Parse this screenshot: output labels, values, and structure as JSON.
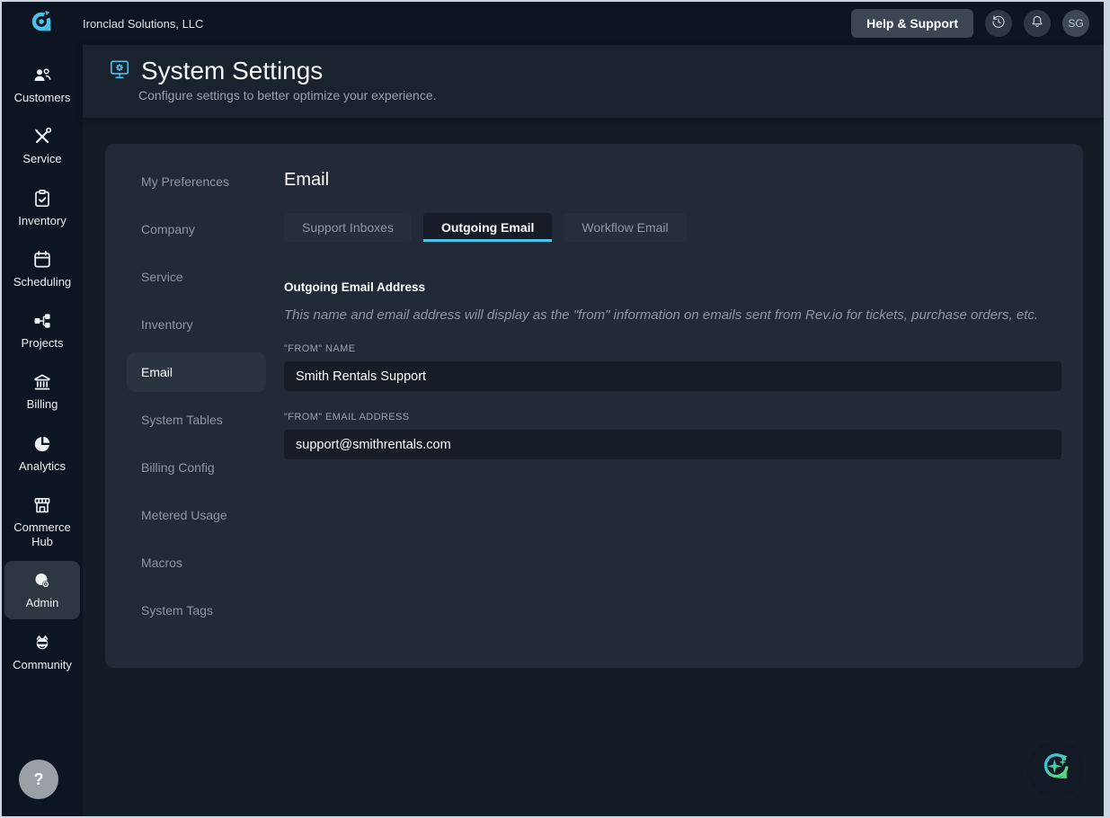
{
  "topbar": {
    "company": "Ironclad Solutions, LLC",
    "help_button": "Help & Support",
    "avatar_initials": "SG",
    "icons": [
      "revio-logo-icon",
      "history-icon",
      "bell-icon"
    ]
  },
  "sidebar": {
    "items": [
      {
        "label": "Customers",
        "icon": "customers-icon",
        "active": false
      },
      {
        "label": "Service",
        "icon": "service-icon",
        "active": false
      },
      {
        "label": "Inventory",
        "icon": "inventory-icon",
        "active": false
      },
      {
        "label": "Scheduling",
        "icon": "scheduling-icon",
        "active": false
      },
      {
        "label": "Projects",
        "icon": "projects-icon",
        "active": false
      },
      {
        "label": "Billing",
        "icon": "billing-icon",
        "active": false
      },
      {
        "label": "Analytics",
        "icon": "analytics-icon",
        "active": false
      },
      {
        "label": "Commerce Hub",
        "icon": "commerce-hub-icon",
        "active": false
      },
      {
        "label": "Admin",
        "icon": "admin-icon",
        "active": true
      },
      {
        "label": "Community",
        "icon": "community-icon",
        "active": false
      }
    ]
  },
  "page_header": {
    "title": "System Settings",
    "subtitle": "Configure settings to better optimize your experience.",
    "icon": "system-settings-monitor-gear-icon"
  },
  "settings_nav": {
    "items": [
      "My Preferences",
      "Company",
      "Service",
      "Inventory",
      "Email",
      "System Tables",
      "Billing Config",
      "Metered Usage",
      "Macros",
      "System Tags"
    ],
    "active_item": "Email"
  },
  "content": {
    "heading": "Email",
    "tabs": [
      "Support Inboxes",
      "Outgoing Email",
      "Workflow Email"
    ],
    "active_tab": "Outgoing Email",
    "section": {
      "title": "Outgoing Email Address",
      "description": "This name and email address will display as the \"from\" information on emails sent from Rev.io for tickets, purchase orders, etc.",
      "fields": [
        {
          "label": "\"FROM\" NAME",
          "value": "Smith Rentals Support"
        },
        {
          "label": "\"FROM\" EMAIL ADDRESS",
          "value": "support@smithrentals.com"
        }
      ]
    }
  },
  "floating": {
    "help_label": "?",
    "ai_button_icon": "ai-sparkle-refresh-icon"
  },
  "colors": {
    "accent_cyan": "#4cc2e6",
    "ai_gradient_start": "#3bb7e8",
    "ai_gradient_end": "#58e36b",
    "sidebar_bg": "#0d1522",
    "header_band_bg": "#1a222e",
    "content_bg": "#151c26",
    "card_bg": "#212a36",
    "input_bg": "#161d27"
  }
}
